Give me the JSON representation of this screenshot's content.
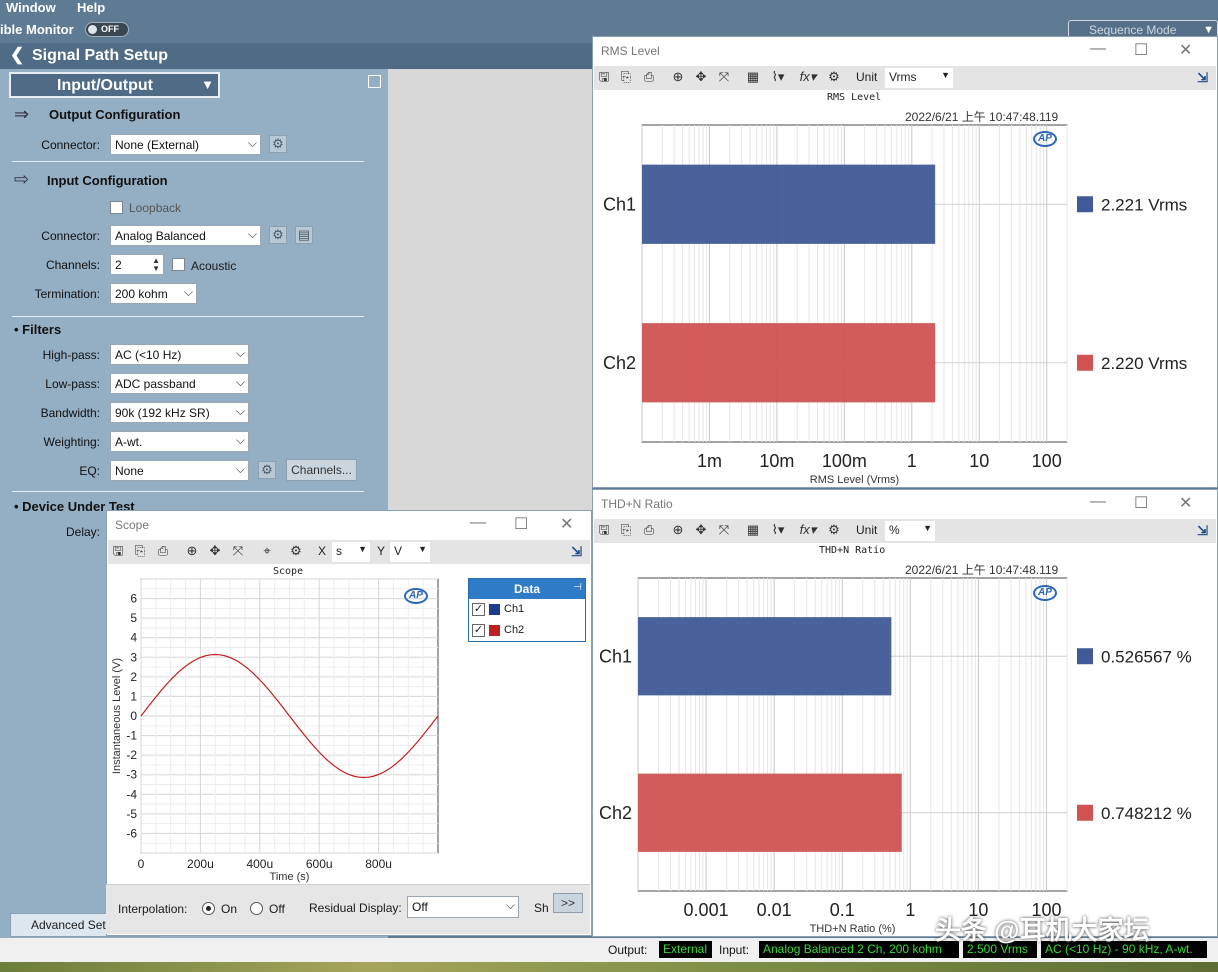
{
  "menu": {
    "window": "Window",
    "help": "Help"
  },
  "monitor": {
    "label": "ible Monitor",
    "toggle": "OFF"
  },
  "sequence_mode": "Sequence Mode",
  "left_panel": {
    "title": "Signal Path Setup",
    "selector": "Input/Output",
    "output_config": {
      "heading": "Output Configuration",
      "connector_label": "Connector:",
      "connector_value": "None (External)"
    },
    "input_config": {
      "heading": "Input Configuration",
      "loopback": "Loopback",
      "connector_label": "Connector:",
      "connector_value": "Analog Balanced",
      "channels_label": "Channels:",
      "channels_value": "2",
      "acoustic": "Acoustic",
      "termination_label": "Termination:",
      "termination_value": "200 kohm"
    },
    "filters": {
      "heading": "Filters",
      "highpass_label": "High-pass:",
      "highpass_value": "AC (<10 Hz)",
      "lowpass_label": "Low-pass:",
      "lowpass_value": "ADC passband",
      "bandwidth_label": "Bandwidth:",
      "bandwidth_value": "90k (192 kHz SR)",
      "weighting_label": "Weighting:",
      "weighting_value": "A-wt.",
      "eq_label": "EQ:",
      "eq_value": "None",
      "channels_button": "Channels..."
    },
    "dut": {
      "heading": "Device Under Test",
      "delay_label": "Delay:"
    },
    "advanced_button": "Advanced Setti"
  },
  "rms_window": {
    "title": "RMS Level",
    "unit_label": "Unit",
    "unit_value": "Vrms",
    "chart_title": "RMS Level",
    "timestamp": "2022/6/21 上午 10:47:48.119",
    "logo": "AP"
  },
  "thd_window": {
    "title": "THD+N Ratio",
    "unit_label": "Unit",
    "unit_value": "%",
    "chart_title": "THD+N Ratio",
    "timestamp": "2022/6/21 上午 10:47:48.119",
    "logo": "AP"
  },
  "scope_window": {
    "title": "Scope",
    "x_label": "X",
    "x_unit": "s",
    "y_label": "Y",
    "y_unit": "V",
    "chart_title": "Scope",
    "logo": "AP",
    "legend_header": "Data",
    "legend": [
      {
        "name": "Ch1",
        "color": "#1f3c8c"
      },
      {
        "name": "Ch2",
        "color": "#c02020"
      }
    ],
    "interpolation_label": "Interpolation:",
    "interp_on": "On",
    "interp_off": "Off",
    "residual_label": "Residual Display:",
    "residual_value": "Off",
    "sh_label": "Sh",
    "more_button": ">>"
  },
  "chart_data": [
    {
      "type": "bar",
      "orientation": "horizontal",
      "title": "RMS Level",
      "xlabel": "RMS Level (Vrms)",
      "xscale": "log",
      "xlim": [
        0.0001,
        200
      ],
      "xticks": [
        "1m",
        "10m",
        "100m",
        "1",
        "10",
        "100"
      ],
      "categories": [
        "Ch1",
        "Ch2"
      ],
      "values": [
        2.221,
        2.22
      ],
      "value_labels": [
        "2.221  Vrms",
        "2.220  Vrms"
      ],
      "colors": [
        "#3f5a96",
        "#d05252"
      ]
    },
    {
      "type": "bar",
      "orientation": "horizontal",
      "title": "THD+N Ratio",
      "xlabel": "THD+N Ratio (%)",
      "xscale": "log",
      "xlim": [
        0.0001,
        200
      ],
      "xticks": [
        "0.001",
        "0.01",
        "0.1",
        "1",
        "10",
        "100"
      ],
      "categories": [
        "Ch1",
        "Ch2"
      ],
      "values": [
        0.526567,
        0.748212
      ],
      "value_labels": [
        "0.526567 %",
        "0.748212 %"
      ],
      "colors": [
        "#3f5a96",
        "#d05252"
      ]
    },
    {
      "type": "line",
      "title": "Scope",
      "xlabel": "Time (s)",
      "ylabel": "Instantaneous Level (V)",
      "xlim": [
        0,
        0.001
      ],
      "ylim": [
        -7,
        7
      ],
      "xticks": [
        "0",
        "200u",
        "400u",
        "600u",
        "800u"
      ],
      "yticks": [
        "6",
        "5",
        "4",
        "3",
        "2",
        "1",
        "0",
        "-1",
        "-2",
        "-3",
        "-4",
        "-5",
        "-6"
      ],
      "series": [
        {
          "name": "Ch2",
          "amplitude": 3.14,
          "frequency_hz": 1000,
          "color": "#c02020"
        }
      ]
    }
  ],
  "status": {
    "output_label": "Output:",
    "output_value": "External",
    "input_label": "Input:",
    "input_value": "Analog Balanced 2 Ch, 200 kohm",
    "level_value": "2.500 Vrms",
    "filter_value": "AC (<10 Hz) - 90 kHz, A-wt."
  },
  "watermark": "头条 @耳机大家坛"
}
